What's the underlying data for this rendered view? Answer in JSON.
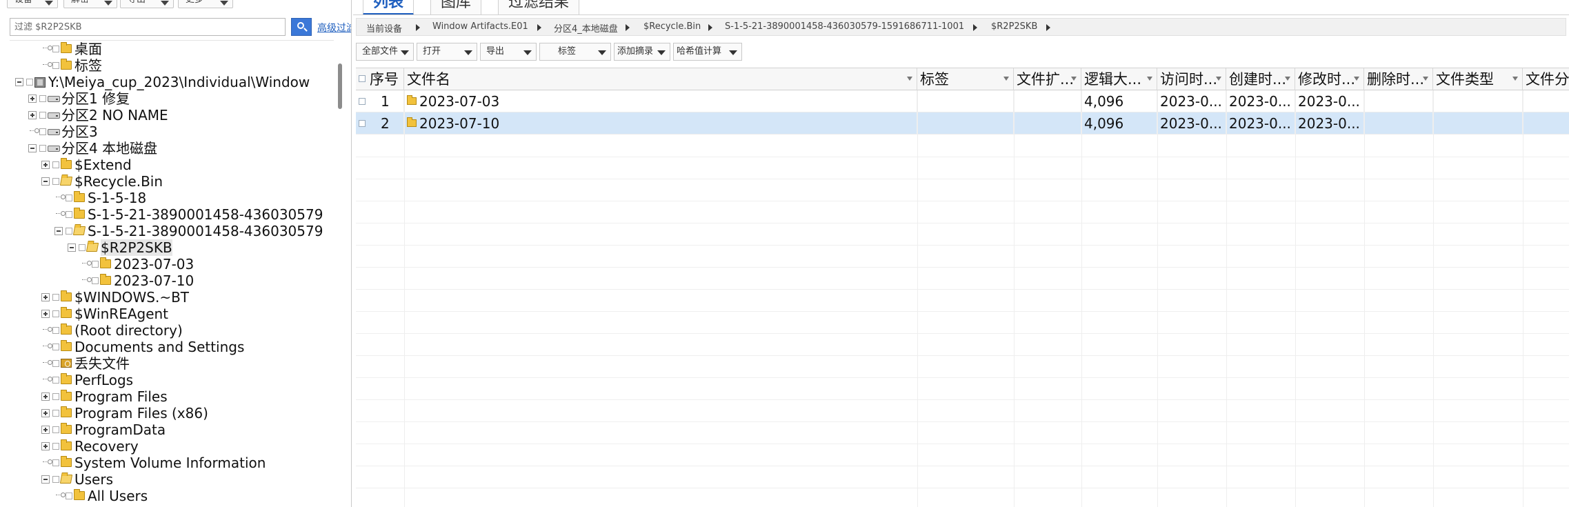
{
  "left": {
    "toolbar": [
      {
        "label": "设备"
      },
      {
        "label": "解密"
      },
      {
        "label": "导出"
      },
      {
        "label": "更多"
      }
    ],
    "filter": {
      "value": "",
      "placeholder": "过滤 $R2P2SKB",
      "advanced_label": "高级过滤"
    },
    "tree": [
      {
        "label": "桌面",
        "icon": "folder-icon",
        "level": 2,
        "expander": "leaf"
      },
      {
        "label": "标签",
        "icon": "folder-icon",
        "level": 2,
        "expander": "leaf"
      },
      {
        "label": "Y:\\Meiya_cup_2023\\Individual\\Window",
        "icon": "disk-image-icon",
        "level": 0,
        "expander": "minus"
      },
      {
        "label": "分区1 修复",
        "icon": "drive-icon",
        "level": 1,
        "expander": "plus"
      },
      {
        "label": "分区2 NO NAME",
        "icon": "drive-icon",
        "level": 1,
        "expander": "plus"
      },
      {
        "label": "分区3",
        "icon": "drive-icon",
        "level": 1,
        "expander": "leaf"
      },
      {
        "label": "分区4 本地磁盘",
        "icon": "drive-icon",
        "level": 1,
        "expander": "minus"
      },
      {
        "label": "$Extend",
        "icon": "folder-icon",
        "level": 2,
        "expander": "plus"
      },
      {
        "label": "$Recycle.Bin",
        "icon": "folder-icon",
        "level": 2,
        "expander": "minus"
      },
      {
        "label": "S-1-5-18",
        "icon": "folder-icon",
        "level": 3,
        "expander": "leaf"
      },
      {
        "label": "S-1-5-21-3890001458-436030579",
        "icon": "folder-icon",
        "level": 3,
        "expander": "leaf"
      },
      {
        "label": "S-1-5-21-3890001458-436030579",
        "icon": "folder-icon",
        "level": 3,
        "expander": "minus"
      },
      {
        "label": "$R2P2SKB",
        "icon": "folder-icon",
        "level": 4,
        "expander": "minus",
        "selected": true
      },
      {
        "label": "2023-07-03",
        "icon": "folder-icon",
        "level": 5,
        "expander": "leaf"
      },
      {
        "label": "2023-07-10",
        "icon": "folder-icon",
        "level": 5,
        "expander": "leaf"
      },
      {
        "label": "$WINDOWS.~BT",
        "icon": "folder-icon",
        "level": 2,
        "expander": "plus"
      },
      {
        "label": "$WinREAgent",
        "icon": "folder-icon",
        "level": 2,
        "expander": "plus"
      },
      {
        "label": "(Root directory)",
        "icon": "folder-icon",
        "level": 2,
        "expander": "leaf"
      },
      {
        "label": "Documents and Settings",
        "icon": "folder-icon",
        "level": 2,
        "expander": "leaf"
      },
      {
        "label": "丢失文件",
        "icon": "lost-files-icon",
        "level": 2,
        "expander": "leaf"
      },
      {
        "label": "PerfLogs",
        "icon": "folder-icon",
        "level": 2,
        "expander": "leaf"
      },
      {
        "label": "Program Files",
        "icon": "folder-icon",
        "level": 2,
        "expander": "plus"
      },
      {
        "label": "Program Files (x86)",
        "icon": "folder-icon",
        "level": 2,
        "expander": "plus"
      },
      {
        "label": "ProgramData",
        "icon": "folder-icon",
        "level": 2,
        "expander": "plus"
      },
      {
        "label": "Recovery",
        "icon": "folder-icon",
        "level": 2,
        "expander": "plus"
      },
      {
        "label": "System Volume Information",
        "icon": "folder-icon",
        "level": 2,
        "expander": "leaf"
      },
      {
        "label": "Users",
        "icon": "folder-icon",
        "level": 2,
        "expander": "minus"
      },
      {
        "label": "All Users",
        "icon": "folder-icon",
        "level": 3,
        "expander": "leaf"
      }
    ]
  },
  "right": {
    "tabs": [
      {
        "label": "列表",
        "active": true
      },
      {
        "label": "图库",
        "active": false
      },
      {
        "label": "过滤结果",
        "active": false
      }
    ],
    "breadcrumb": [
      "当前设备",
      "Window Artifacts.E01",
      "分区4_本地磁盘",
      "$Recycle.Bin",
      "S-1-5-21-3890001458-436030579-1591686711-1001",
      "$R2P2SKB"
    ],
    "toolbar": [
      {
        "label": "全部文件"
      },
      {
        "label": "打开"
      },
      {
        "label": "导出"
      },
      {
        "label": "标签"
      },
      {
        "label": "添加摘录"
      },
      {
        "label": "哈希值计算"
      }
    ],
    "columns": [
      "序号",
      "文件名",
      "标签",
      "文件扩...",
      "逻辑大...",
      "访问时...",
      "创建时...",
      "修改时...",
      "删除时...",
      "文件类型",
      "文件分"
    ],
    "rows": [
      {
        "index": "1",
        "name": "2023-07-03",
        "tag": "",
        "ext": "",
        "size": "4,096",
        "accessed": "2023-0...",
        "created": "2023-0...",
        "modified": "2023-0...",
        "deleted": "",
        "type": "",
        "category": "",
        "selected": false
      },
      {
        "index": "2",
        "name": "2023-07-10",
        "tag": "",
        "ext": "",
        "size": "4,096",
        "accessed": "2023-0...",
        "created": "2023-0...",
        "modified": "2023-0...",
        "deleted": "",
        "type": "",
        "category": "",
        "selected": true
      }
    ]
  },
  "colors": {
    "accent": "#1f5fbf",
    "selection": "#d4e6f8",
    "folder": "#f2c23c"
  }
}
